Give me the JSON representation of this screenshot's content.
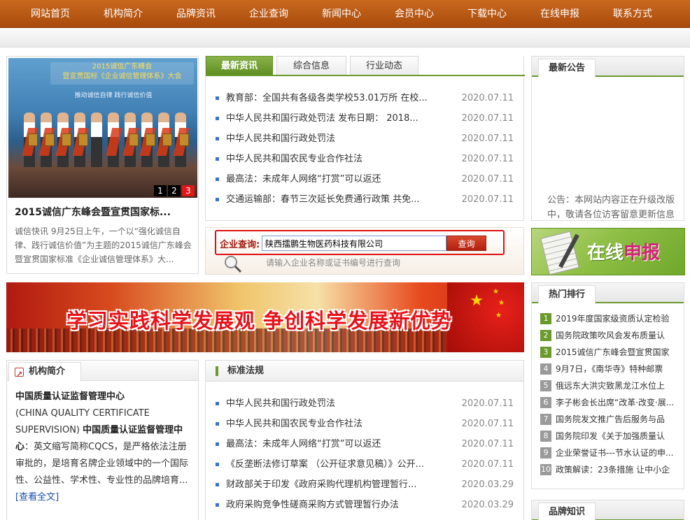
{
  "nav": [
    "网站首页",
    "机构简介",
    "品牌资讯",
    "企业查询",
    "新闻中心",
    "会员中心",
    "下载中心",
    "在线申报",
    "联系方式"
  ],
  "feature": {
    "photo_banner_line1": "2015诚信广东峰会",
    "photo_banner_line2": "暨宣贯国标《企业诚信管理体系》大会",
    "photo_sub": "推动诚信自律  践行诚信价值",
    "pager": [
      "1",
      "2",
      "3"
    ],
    "title": "2015诚信广东峰会暨宣贯国家标...",
    "desc": "诚信快讯 9月25日上午，一个以“强化诚信自律、践行诚信价值”为主题的2015诚信广东峰会暨宣贯国家标准《企业诚信管理体系》大..."
  },
  "news": {
    "tabs": [
      "最新资讯",
      "综合信息",
      "行业动态"
    ],
    "items": [
      {
        "title": "教育部：全国共有各级各类学校53.01万所 在校...",
        "date": "2020.07.11"
      },
      {
        "title": "中华人民共和国行政处罚法  发布日期： 2018...",
        "date": "2020.07.11"
      },
      {
        "title": "中华人民共和国行政处罚法",
        "date": "2020.07.11"
      },
      {
        "title": "中华人民共和国农民专业合作社法",
        "date": "2020.07.11"
      },
      {
        "title": "最高法：未成年人网络“打赏”可以返还",
        "date": "2020.07.11"
      },
      {
        "title": "交通运输部：春节三次延长免费通行政策 共免...",
        "date": "2020.07.11"
      }
    ]
  },
  "search": {
    "label": "企业查询:",
    "value": "陕西擂鹏生物医药科技有限公司",
    "button": "查询",
    "hint": "请输入企业名称或证书编号进行查询"
  },
  "banner": {
    "slogan": "学习实践科学发展观  争创科学发展新优势"
  },
  "org": {
    "tab": "机构简介",
    "name_cn": "中国质量认证监督管理中心",
    "name_en": "(CHINA QUALITY CERTIFICATE SUPERVISION)",
    "name_cn2": "中国质量认证监督管理中心",
    "body": "：英文缩写简称CQCS，是严格依法注册审批的，是培育名牌企业领域中的一个国际性、公益性、学术性、专业性的品牌培育...",
    "more": "[查看全文]"
  },
  "regs": {
    "title": "标准法规",
    "items": [
      {
        "title": "中华人民共和国行政处罚法",
        "date": "2020.07.11"
      },
      {
        "title": "中华人民共和国农民专业合作社法",
        "date": "2020.07.11"
      },
      {
        "title": "最高法：未成年人网络“打赏”可以返还",
        "date": "2020.07.11"
      },
      {
        "title": "《反垄断法修订草案 （公开征求意见稿）》公开...",
        "date": "2020.07.11"
      },
      {
        "title": "财政部关于印发《政府采购代理机构管理暂行...",
        "date": "2020.03.29"
      },
      {
        "title": "政府采购竞争性磋商采购方式管理暂行办法",
        "date": "2020.03.29"
      }
    ]
  },
  "notice": {
    "title": "最新公告",
    "body": "公告：本网站内容正在升级改版中，敬请各位访客留意更新信息"
  },
  "online": {
    "text1": "在线",
    "text2": "申报"
  },
  "hot": {
    "title": "热门排行",
    "items": [
      {
        "num": "1",
        "title": "2019年度国家级资质认定检验"
      },
      {
        "num": "2",
        "title": "国务院政策吹风会发布质量认"
      },
      {
        "num": "3",
        "title": "2015诚信广东峰会暨宣贯国家"
      },
      {
        "num": "4",
        "title": "9月7日，《南华寺》特种邮票"
      },
      {
        "num": "5",
        "title": "俄远东大洪灾致黑龙江水位上"
      },
      {
        "num": "6",
        "title": "李子彬会长出席“改革·改变·展..."
      },
      {
        "num": "7",
        "title": "国务院发文推广告后服务与品"
      },
      {
        "num": "8",
        "title": "国务院印发《关于加强质量认"
      },
      {
        "num": "9",
        "title": "企业荣誉证书---节水认证的申..."
      },
      {
        "num": "10",
        "title": "政策解读：23条措施 让中小企"
      }
    ]
  },
  "brand": {
    "title": "品牌知识"
  }
}
